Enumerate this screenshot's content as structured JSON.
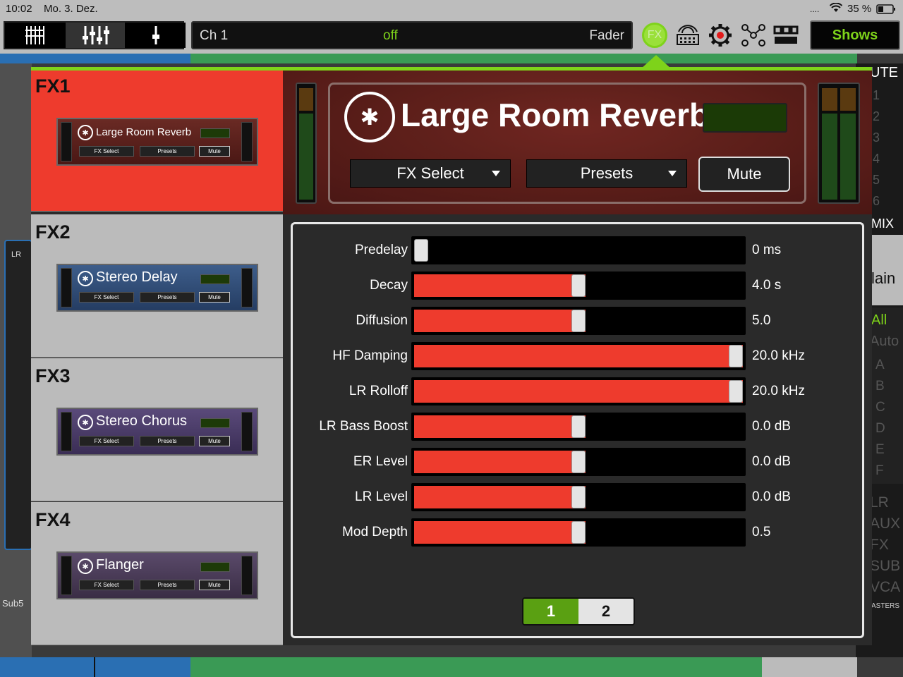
{
  "status": {
    "time": "10:02",
    "date": "Mo. 3. Dez.",
    "battery": "35 %"
  },
  "topbar": {
    "channel": "Ch 1",
    "state": "off",
    "mode": "Fader",
    "fx_icon_label": "FX",
    "shows_label": "Shows"
  },
  "right_bg": {
    "mute": "UTE",
    "nums": [
      "1",
      "2",
      "3",
      "4",
      "5",
      "6"
    ],
    "mix": "MIX",
    "main": "lain",
    "all": "All",
    "auto": "Auto",
    "groups": [
      "A",
      "B",
      "C",
      "D",
      "E",
      "F"
    ],
    "types": [
      "LR",
      "AUX",
      "FX",
      "SUB",
      "VCA"
    ],
    "masters": "ASTERS"
  },
  "left_bg": {
    "lr": "LR",
    "sub": "Sub5"
  },
  "fx_tabs": [
    {
      "tab": "FX1",
      "name": "Large Room Reverb"
    },
    {
      "tab": "FX2",
      "name": "Stereo Delay"
    },
    {
      "tab": "FX3",
      "name": "Stereo Chorus"
    },
    {
      "tab": "FX4",
      "name": "Flanger"
    }
  ],
  "mini_labels": {
    "fx_select": "FX Select",
    "presets": "Presets",
    "mute": "Mute"
  },
  "header": {
    "title": "Large Room Reverb",
    "fx_select": "FX Select",
    "presets": "Presets",
    "mute": "Mute"
  },
  "params": [
    {
      "label": "Predelay",
      "value": "0 ms",
      "level": 0.0
    },
    {
      "label": "Decay",
      "value": "4.0 s",
      "level": 0.5
    },
    {
      "label": "Diffusion",
      "value": "5.0",
      "level": 0.5
    },
    {
      "label": "HF Damping",
      "value": "20.0 kHz",
      "level": 1.0
    },
    {
      "label": "LR Rolloff",
      "value": "20.0 kHz",
      "level": 1.0
    },
    {
      "label": "LR Bass Boost",
      "value": "0.0 dB",
      "level": 0.5
    },
    {
      "label": "ER Level",
      "value": "0.0 dB",
      "level": 0.5
    },
    {
      "label": "LR Level",
      "value": "0.0 dB",
      "level": 0.5
    },
    {
      "label": "Mod Depth",
      "value": "0.5",
      "level": 0.5
    }
  ],
  "pager": {
    "page1": "1",
    "page2": "2",
    "active": 1
  },
  "colors": {
    "accent": "#7ed31a",
    "fill": "#ee3b2d",
    "selected_tab": "#ee3b2d"
  }
}
